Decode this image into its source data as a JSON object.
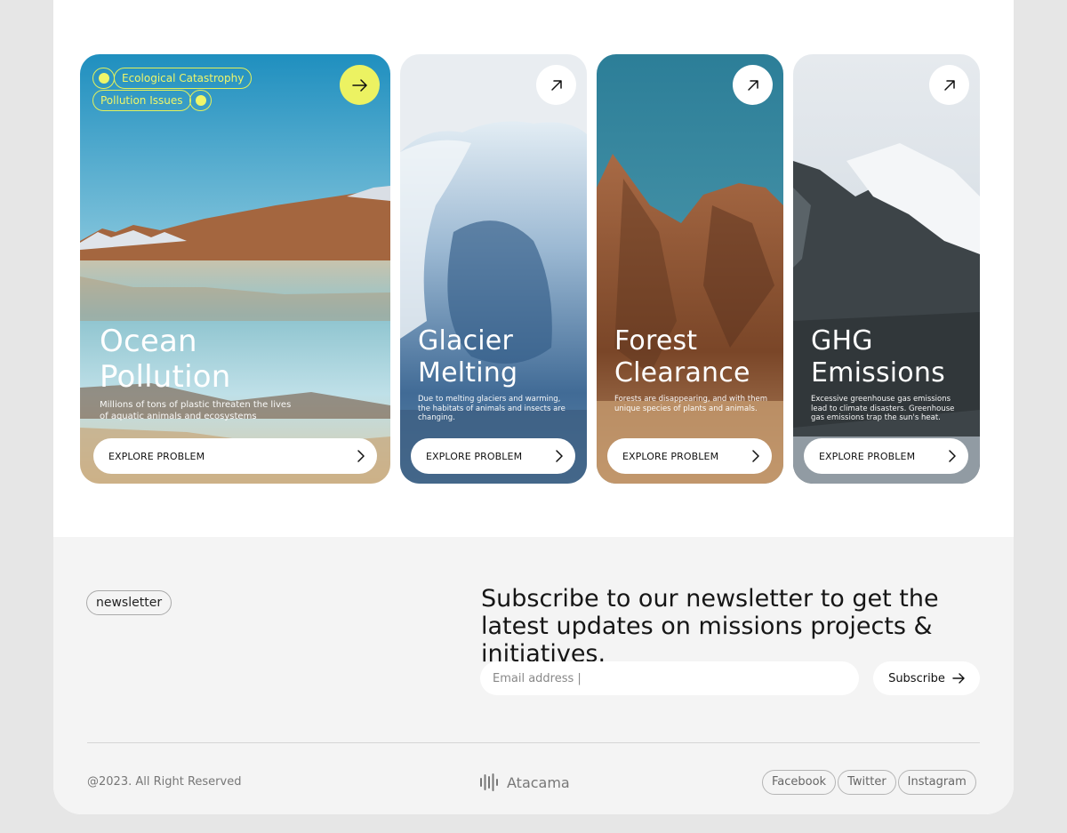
{
  "cards": [
    {
      "title_line1": "Ocean",
      "title_line2": "Pollution",
      "description": "Millions of tons of plastic threaten the lives of aquatic animals and ecosystems",
      "cta": "EXPLORE PROBLEM",
      "tags": [
        "Ecological Catastrophy",
        "Pollution Issues"
      ]
    },
    {
      "title_line1": "Glacier",
      "title_line2": "Melting",
      "description": "Due to melting glaciers and warming, the habitats of animals and insects are changing.",
      "cta": "EXPLORE PROBLEM"
    },
    {
      "title_line1": "Forest",
      "title_line2": "Clearance",
      "description": "Forests are disappearing, and with them unique species of plants and animals.",
      "cta": "EXPLORE PROBLEM"
    },
    {
      "title_line1": "GHG",
      "title_line2": "Emissions",
      "description": "Excessive greenhouse gas emissions lead to climate disasters. Greenhouse gas emissions trap the sun's heat.",
      "cta": "EXPLORE PROBLEM"
    }
  ],
  "newsletter": {
    "label": "newsletter",
    "headline": "Subscribe to our newsletter to get the latest updates on missions projects & initiatives.",
    "email_placeholder": "Email address |",
    "subscribe_label": "Subscribe"
  },
  "footer": {
    "copyright": "@2023. All Right Reserved",
    "brand": "Atacama",
    "socials": [
      "Facebook",
      "Twitter",
      "Instagram"
    ]
  },
  "colors": {
    "accent": "#ecf262",
    "page_bg": "#e6e6e6",
    "footer_bg": "#f4f4f4"
  },
  "icons": [
    "arrow-right-icon",
    "arrow-up-right-icon",
    "chevron-right-icon",
    "atacama-logo-icon"
  ]
}
